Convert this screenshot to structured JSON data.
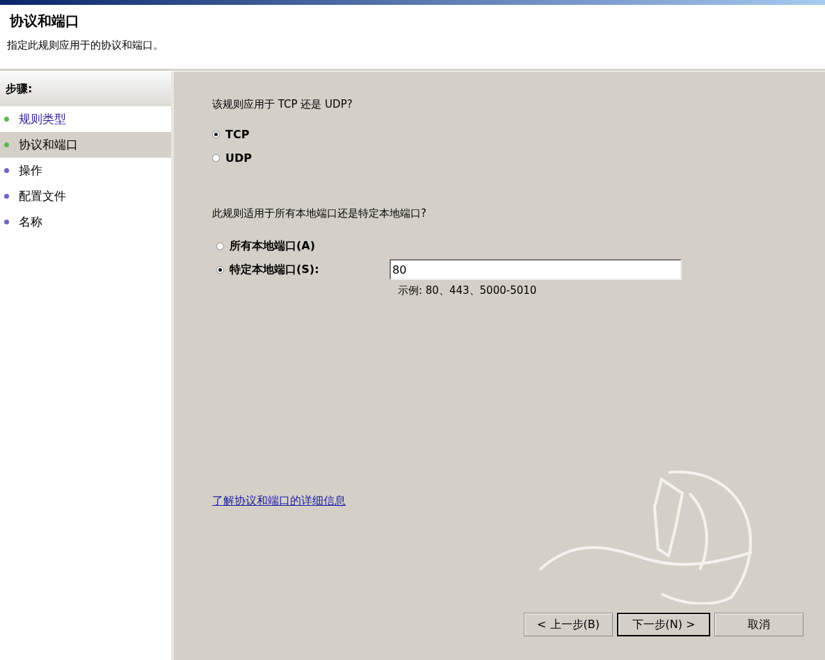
{
  "header": {
    "title": "协议和端口",
    "subtitle": "指定此规则应用于的协议和端口。"
  },
  "steps": {
    "title": "步骤:",
    "items": [
      {
        "label": "规则类型",
        "color": "#55bb44",
        "selected": false,
        "kind": "link"
      },
      {
        "label": "协议和端口",
        "color": "#55bb44",
        "selected": true,
        "kind": "plain"
      },
      {
        "label": "操作",
        "color": "#6666cc",
        "selected": false,
        "kind": "plain"
      },
      {
        "label": "配置文件",
        "color": "#6666cc",
        "selected": false,
        "kind": "plain"
      },
      {
        "label": "名称",
        "color": "#6666cc",
        "selected": false,
        "kind": "plain"
      }
    ]
  },
  "protocol": {
    "question": "该规则应用于 TCP 还是 UDP?",
    "options": [
      {
        "label": "TCP",
        "selected": true
      },
      {
        "label": "UDP",
        "selected": false
      }
    ]
  },
  "ports": {
    "question": "此规则适用于所有本地端口还是特定本地端口?",
    "options": [
      {
        "label": "所有本地端口(A)",
        "selected": false
      },
      {
        "label": "特定本地端口(S):",
        "selected": true
      }
    ],
    "value": "80",
    "hint": "示例: 80、443、5000-5010"
  },
  "help_link": "了解协议和端口的详细信息",
  "buttons": [
    {
      "label": "< 上一步(B)",
      "default": false
    },
    {
      "label": "下一步(N) >",
      "default": true
    },
    {
      "label": "取消",
      "default": false
    }
  ]
}
